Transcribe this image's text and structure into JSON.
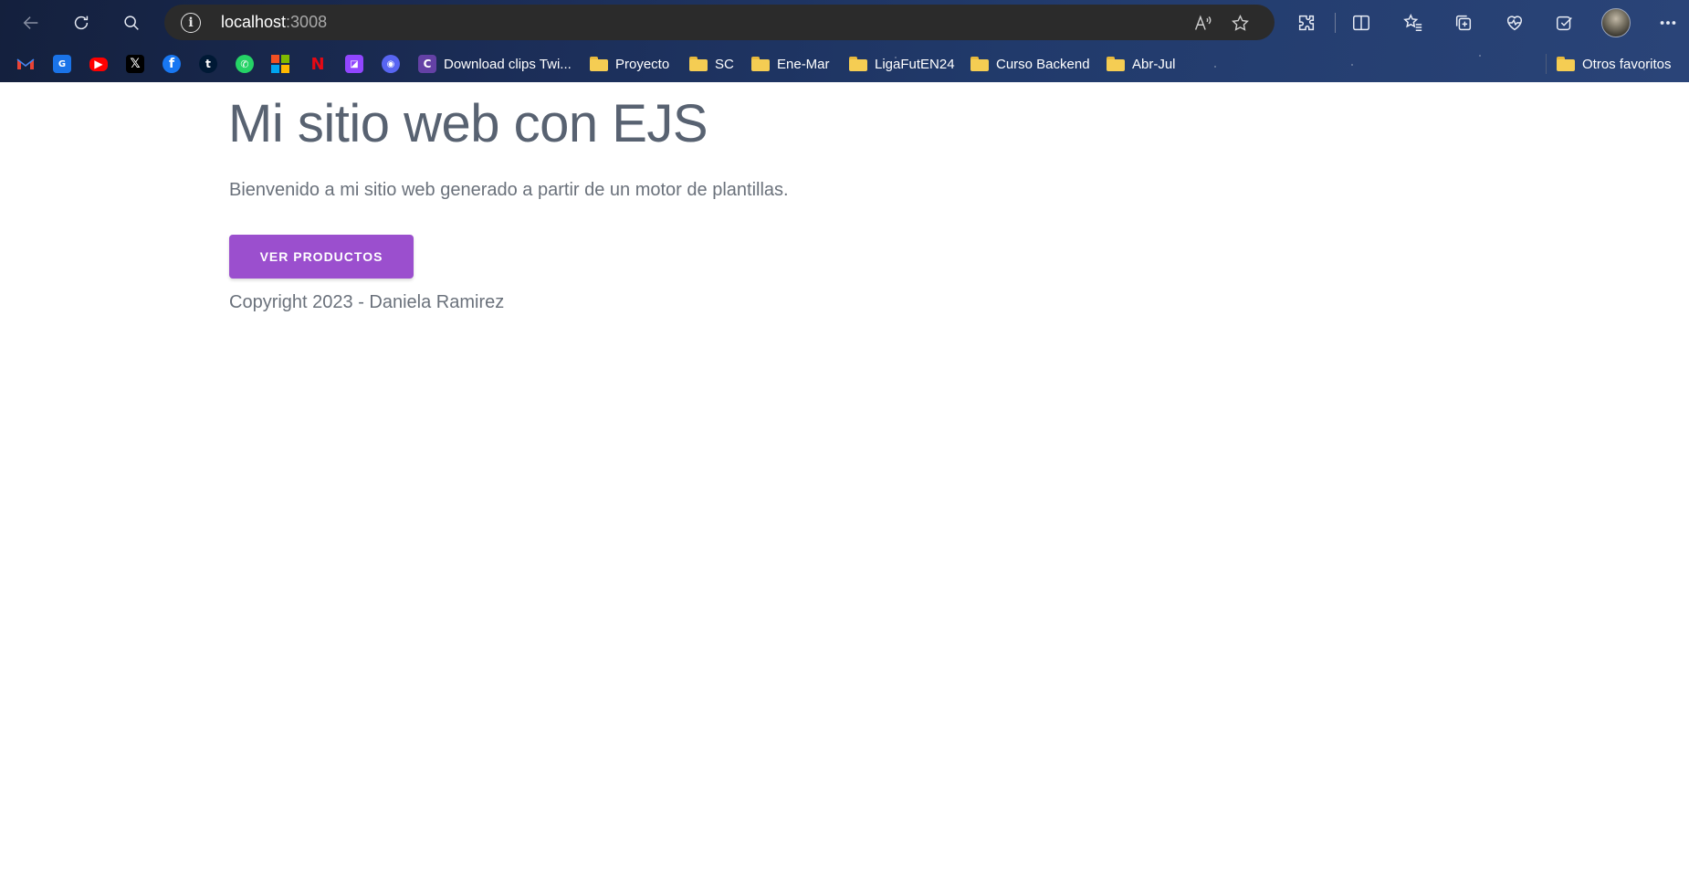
{
  "browser": {
    "address": {
      "host": "localhost",
      "port": ":3008"
    },
    "bookmarks": [
      {
        "type": "favicon",
        "icon": "gmail-icon",
        "label": ""
      },
      {
        "type": "favicon",
        "icon": "translate-icon",
        "label": ""
      },
      {
        "type": "favicon",
        "icon": "youtube-icon",
        "label": ""
      },
      {
        "type": "favicon",
        "icon": "x-icon",
        "label": ""
      },
      {
        "type": "favicon",
        "icon": "facebook-icon",
        "label": ""
      },
      {
        "type": "favicon",
        "icon": "tumblr-icon",
        "label": ""
      },
      {
        "type": "favicon",
        "icon": "whatsapp-icon",
        "label": ""
      },
      {
        "type": "favicon",
        "icon": "microsoft-icon",
        "label": ""
      },
      {
        "type": "favicon",
        "icon": "netflix-icon",
        "label": ""
      },
      {
        "type": "favicon",
        "icon": "twitch-icon",
        "label": ""
      },
      {
        "type": "favicon",
        "icon": "discord-icon",
        "label": ""
      }
    ],
    "bookmark_labels": {
      "clips": "Download clips Twi...",
      "folder_1": "Proyecto",
      "folder_2": "SC",
      "folder_3": "Ene-Mar",
      "folder_4": "LigaFutEN24",
      "folder_5": "Curso Backend",
      "folder_6": "Abr-Jul",
      "other": "Otros favoritos"
    },
    "clips_favicon_letter": "C"
  },
  "page": {
    "title": "Mi sitio web con EJS",
    "lead": "Bienvenido a mi sitio web generado a partir de un motor de plantillas.",
    "button_label": "VER PRODUCTOS",
    "footer": "Copyright 2023 - Daniela Ramirez"
  },
  "colors": {
    "button": "#9b4fce",
    "heading": "#586271",
    "text": "#6a717b"
  }
}
